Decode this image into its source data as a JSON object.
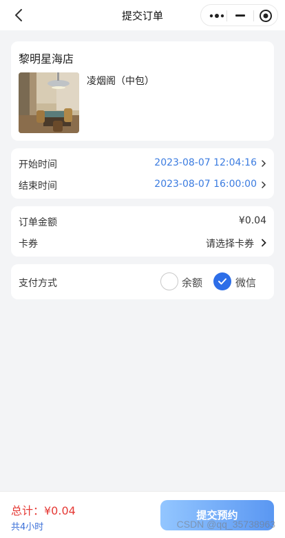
{
  "header": {
    "title": "提交订单",
    "back_icon": "chevron-left-icon"
  },
  "capsule": {
    "more_icon": "more-dots-icon",
    "minimize_icon": "minimize-icon",
    "close_icon": "target-icon"
  },
  "shop": {
    "name": "黎明星海店",
    "room": "凌烟阁（中包）"
  },
  "time": {
    "start_label": "开始时间",
    "start_value": "2023-08-07 12:04:16",
    "end_label": "结束时间",
    "end_value": "2023-08-07 16:00:00"
  },
  "amount": {
    "order_label": "订单金额",
    "order_value": "¥0.04",
    "coupon_label": "卡券",
    "coupon_placeholder": "请选择卡券"
  },
  "payment": {
    "label": "支付方式",
    "options": [
      {
        "label": "余额",
        "selected": false
      },
      {
        "label": "微信",
        "selected": true
      }
    ]
  },
  "footer": {
    "total": "总计：¥0.04",
    "duration": "共4小时",
    "submit_label": "提交预约"
  },
  "watermark": "CSDN @qq_35738963",
  "colors": {
    "accent": "#2d6ee8",
    "price": "#e53935",
    "time": "#3a7be0"
  }
}
